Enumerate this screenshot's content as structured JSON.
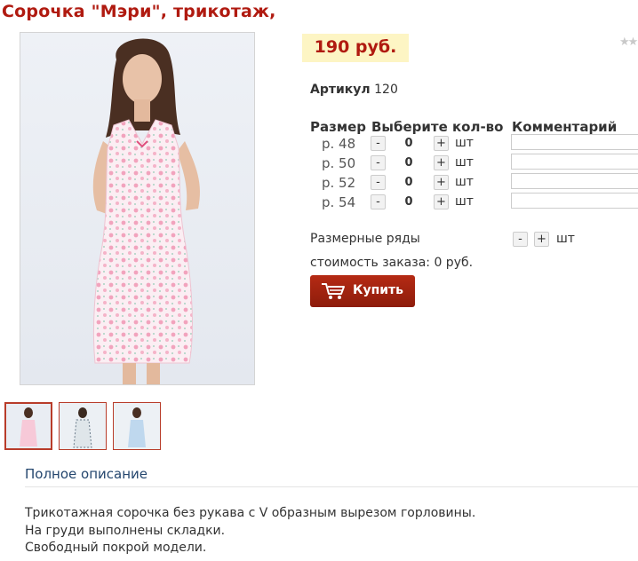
{
  "product": {
    "title": "Сорочка \"Мэри\", трикотаж,",
    "price": "190 руб.",
    "rating_stars": "★★",
    "sku_label": "Артикул",
    "sku_value": "120"
  },
  "table": {
    "col_size": "Размер",
    "col_qty": "Выберите кол-во",
    "col_comment": "Комментарий",
    "rows": [
      {
        "size": "р. 48",
        "qty": "0",
        "unit": "шт"
      },
      {
        "size": "р. 50",
        "qty": "0",
        "unit": "шт"
      },
      {
        "size": "р. 52",
        "qty": "0",
        "unit": "шт"
      },
      {
        "size": "р. 54",
        "qty": "0",
        "unit": "шт"
      }
    ],
    "minus": "-",
    "plus": "+"
  },
  "size_rows": {
    "label": "Размерные ряды",
    "unit": "шт"
  },
  "order_cost": "стоимость заказа: 0 руб.",
  "buy_button": "Купить",
  "description": {
    "link": "Полное описание",
    "lines": [
      "Трикотажная сорочка без рукава с V образным вырезом горловины.",
      "На груди выполнены складки.",
      "Свободный покрой модели."
    ]
  },
  "colors": {
    "accent": "#b01a10",
    "price_bg": "#fdf5c4",
    "link": "#24466e"
  }
}
